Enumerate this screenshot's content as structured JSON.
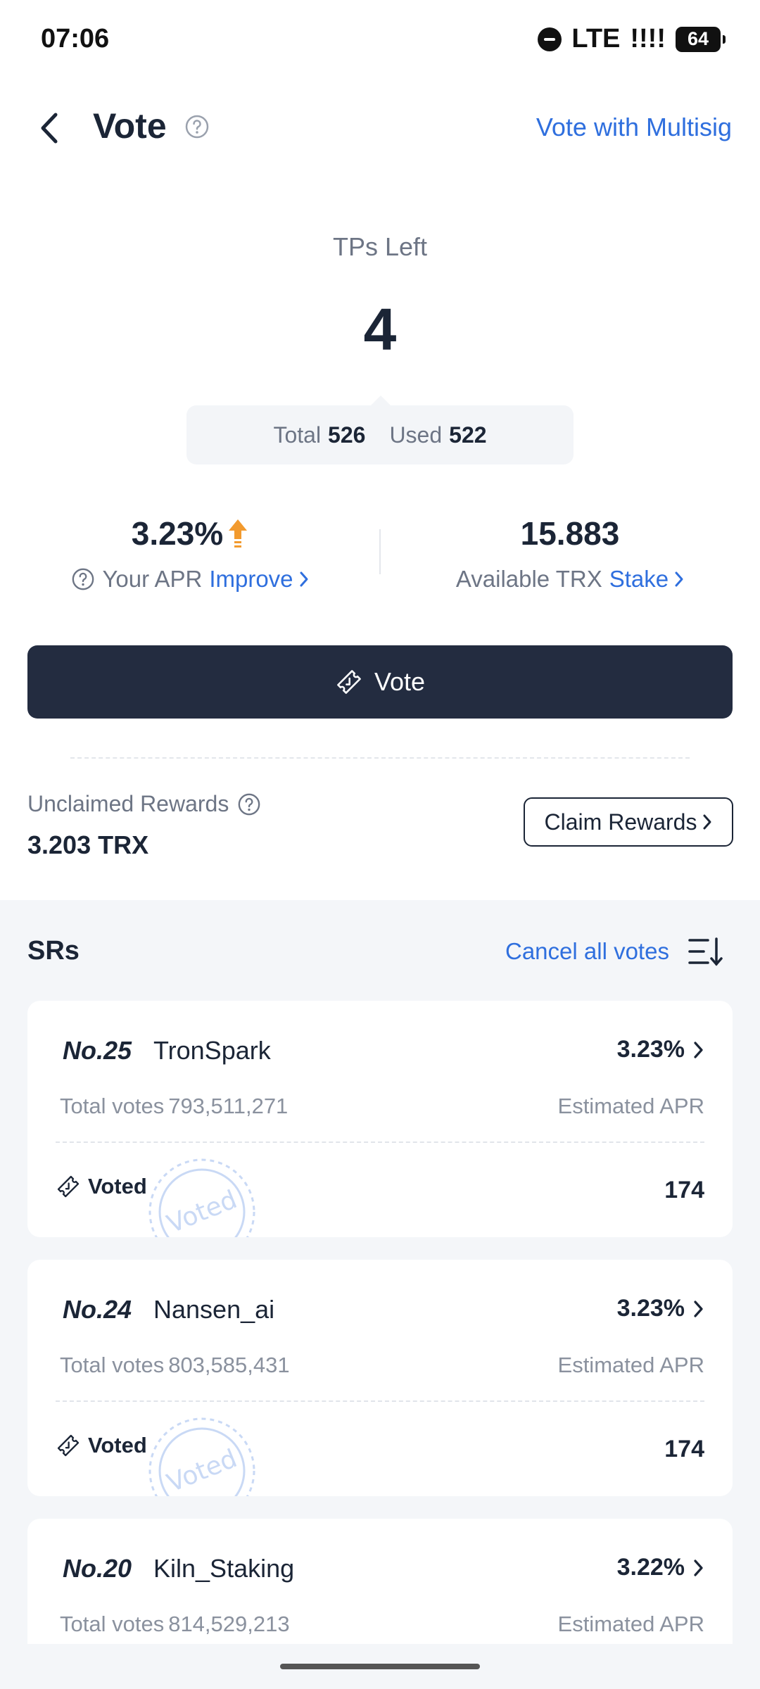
{
  "status_bar": {
    "time": "07:06",
    "network": "LTE",
    "signal": "!!!!",
    "battery": "64"
  },
  "header": {
    "title": "Vote",
    "multisig_label": "Vote with Multisig"
  },
  "tps": {
    "label": "TPs Left",
    "value": "4",
    "total_label": "Total",
    "total": "526",
    "used_label": "Used",
    "used": "522"
  },
  "apr": {
    "value": "3.23%",
    "label": "Your APR",
    "improve_label": "Improve"
  },
  "trx": {
    "value": "15.883",
    "label": "Available TRX",
    "stake_label": "Stake"
  },
  "vote_button": {
    "label": "Vote"
  },
  "rewards": {
    "label": "Unclaimed Rewards",
    "value": "3.203 TRX",
    "claim_label": "Claim Rewards"
  },
  "srs": {
    "title": "SRs",
    "cancel_label": "Cancel all votes",
    "items": [
      {
        "rank": "No.25",
        "name": "TronSpark",
        "apr": "3.23%",
        "votes_label": "Total votes",
        "votes": "793,511,271",
        "apr_label": "Estimated APR",
        "voted_label": "Voted",
        "count": "174"
      },
      {
        "rank": "No.24",
        "name": "Nansen_ai",
        "apr": "3.23%",
        "votes_label": "Total votes",
        "votes": "803,585,431",
        "apr_label": "Estimated APR",
        "voted_label": "Voted",
        "count": "174"
      },
      {
        "rank": "No.20",
        "name": "Kiln_Staking",
        "apr": "3.22%",
        "votes_label": "Total votes",
        "votes": "814,529,213",
        "apr_label": "Estimated APR"
      }
    ]
  },
  "colors": {
    "accent": "#2f6fde",
    "dark": "#232c40",
    "arrow_up": "#f29a2e",
    "stamp": "#c9d9f5"
  },
  "icons": [
    "back-arrow-icon",
    "help-circle-icon",
    "arrow-up-icon",
    "chevron-right-icon",
    "vote-ticket-icon",
    "sort-icon",
    "voted-stamp-icon"
  ]
}
